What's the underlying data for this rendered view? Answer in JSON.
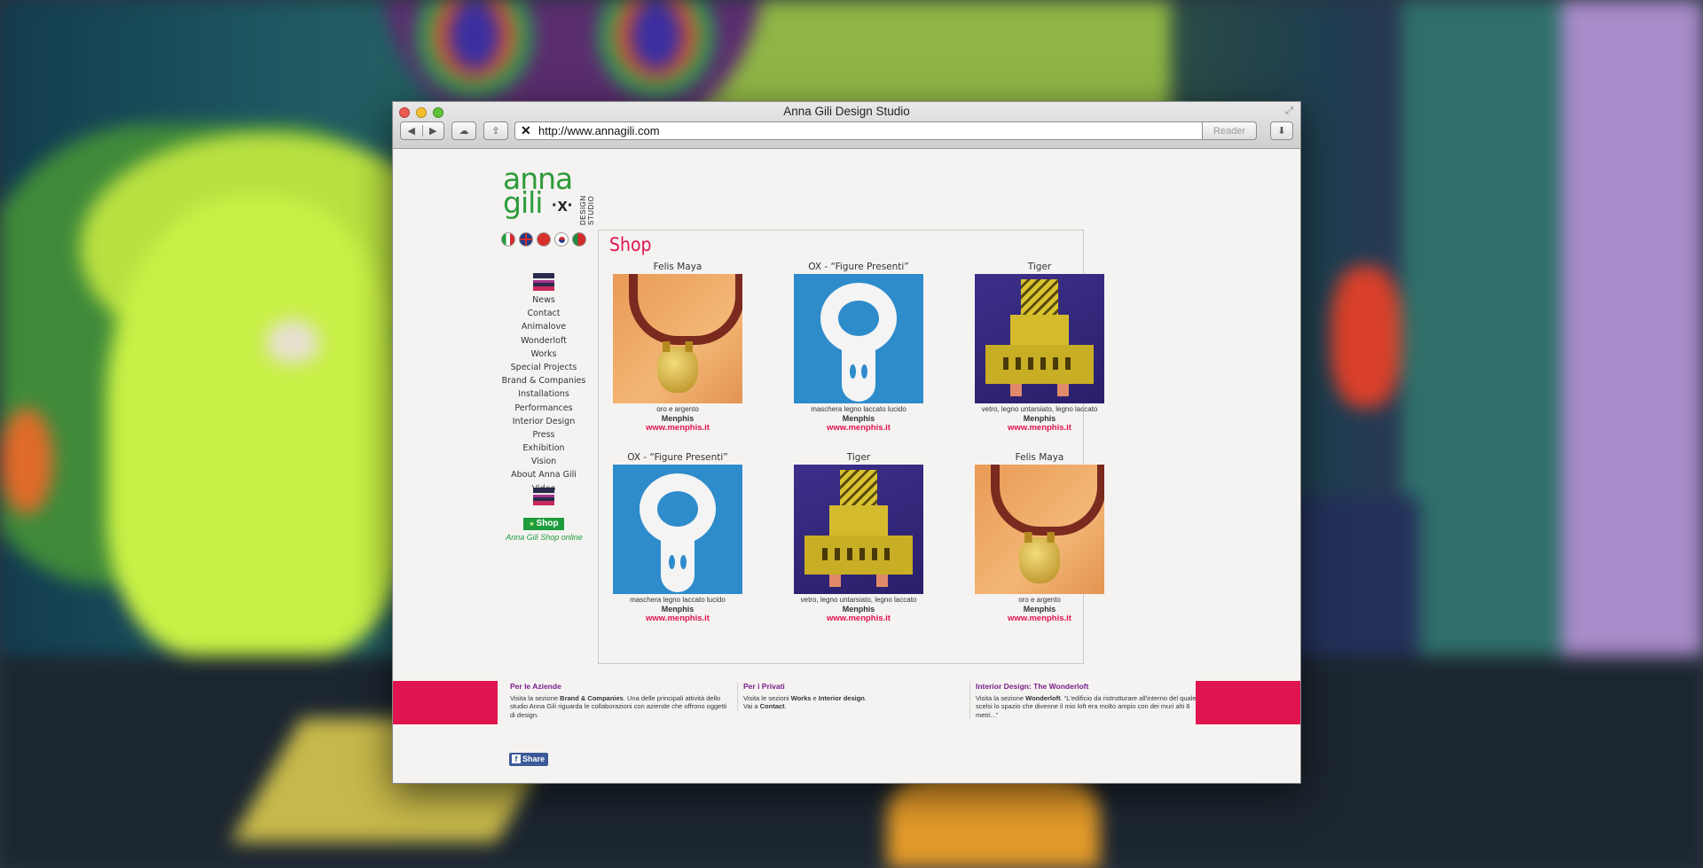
{
  "window": {
    "title": "Anna Gili Design Studio",
    "url": "http://www.annagili.com",
    "reader_label": "Reader"
  },
  "logo": {
    "line1": "anna",
    "line2": "gili",
    "face": "·x·",
    "studio": "DESIGN STUDIO"
  },
  "languages": [
    "Italiano",
    "English",
    "中文",
    "한국어",
    "Português"
  ],
  "menu": [
    "News",
    "Contact",
    "Animalove",
    "Wonderloft",
    "Works",
    "Special Projects",
    "Brand & Companies",
    "Installations",
    "Performances",
    "Interior Design",
    "Press",
    "Exhibition",
    "Vision",
    "About Anna Gili",
    "Video"
  ],
  "shop_button": "Shop",
  "shop_online": "Anna Gili Shop online",
  "panel_title": "Shop",
  "products": [
    {
      "name": "Felis Maya",
      "art": "necklace",
      "desc": "oro e argento",
      "brand": "Menphis",
      "link": "www.menphis.it"
    },
    {
      "name": "OX - “Figure Presenti”",
      "art": "ox",
      "desc": "maschera legno laccato lucido",
      "brand": "Menphis",
      "link": "www.menphis.it"
    },
    {
      "name": "Tiger",
      "art": "tiger",
      "desc": "vetro, legno untarsiato, legno laccato",
      "brand": "Menphis",
      "link": "www.menphis.it"
    },
    {
      "name": "OX - “Figure Presenti”",
      "art": "ox",
      "desc": "maschera legno laccato lucido",
      "brand": "Menphis",
      "link": "www.menphis.it"
    },
    {
      "name": "Tiger",
      "art": "tiger",
      "desc": "vetro, legno untarsiato, legno laccato",
      "brand": "Menphis",
      "link": "www.menphis.it"
    },
    {
      "name": "Felis Maya",
      "art": "necklace",
      "desc": "oro e argento",
      "brand": "Menphis",
      "link": "www.menphis.it"
    }
  ],
  "footer": {
    "col1": {
      "title": "Per le Aziende",
      "text1": "Visita la sezione ",
      "bold1": "Brand & Companies",
      "text2": ". Una delle principali attività dello studio Anna Gili riguarda le collaborazioni con aziende che offrono oggetti di design."
    },
    "col2": {
      "title": "Per i Privati",
      "text1": "Visita le sezioni ",
      "bold1": "Works",
      "mid": " e ",
      "bold2": "Interior design",
      "text2": ".",
      "line2a": "Vai a ",
      "line2b": "Contact",
      "line2c": "."
    },
    "col3": {
      "title": "Interior Design: The Wonderloft",
      "text1": "Visita la sezione ",
      "bold1": "Wonderloft",
      "text2": ". “L'edificio da ristrutturare all'interno del quale scelsi lo spazio che divenne il mio loft era molto ampio con dei muri alti 8 metri...”"
    }
  },
  "fb_share": "Share",
  "colors": {
    "accent": "#e0144e",
    "brand_green": "#2e9b3a",
    "footer_title": "#7a1e8a"
  }
}
